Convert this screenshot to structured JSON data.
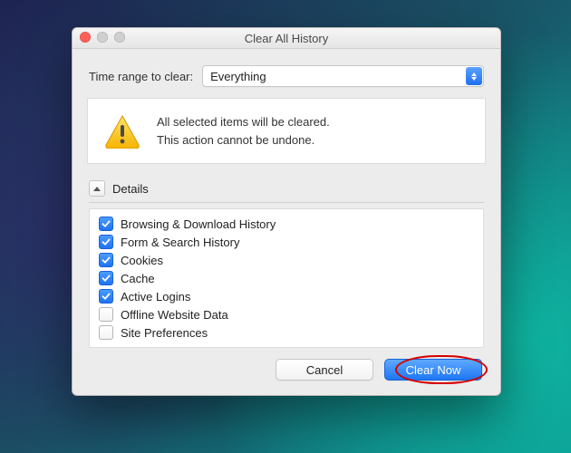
{
  "window": {
    "title": "Clear All History"
  },
  "range": {
    "label": "Time range to clear:",
    "value": "Everything"
  },
  "warning": {
    "line1": "All selected items will be cleared.",
    "line2": "This action cannot be undone."
  },
  "details": {
    "title": "Details",
    "items": [
      {
        "label": "Browsing & Download History",
        "checked": true
      },
      {
        "label": "Form & Search History",
        "checked": true
      },
      {
        "label": "Cookies",
        "checked": true
      },
      {
        "label": "Cache",
        "checked": true
      },
      {
        "label": "Active Logins",
        "checked": true
      },
      {
        "label": "Offline Website Data",
        "checked": false
      },
      {
        "label": "Site Preferences",
        "checked": false
      }
    ]
  },
  "buttons": {
    "cancel": "Cancel",
    "clear": "Clear Now"
  },
  "colors": {
    "accent": "#1f77f3",
    "annotation": "#d40000"
  }
}
